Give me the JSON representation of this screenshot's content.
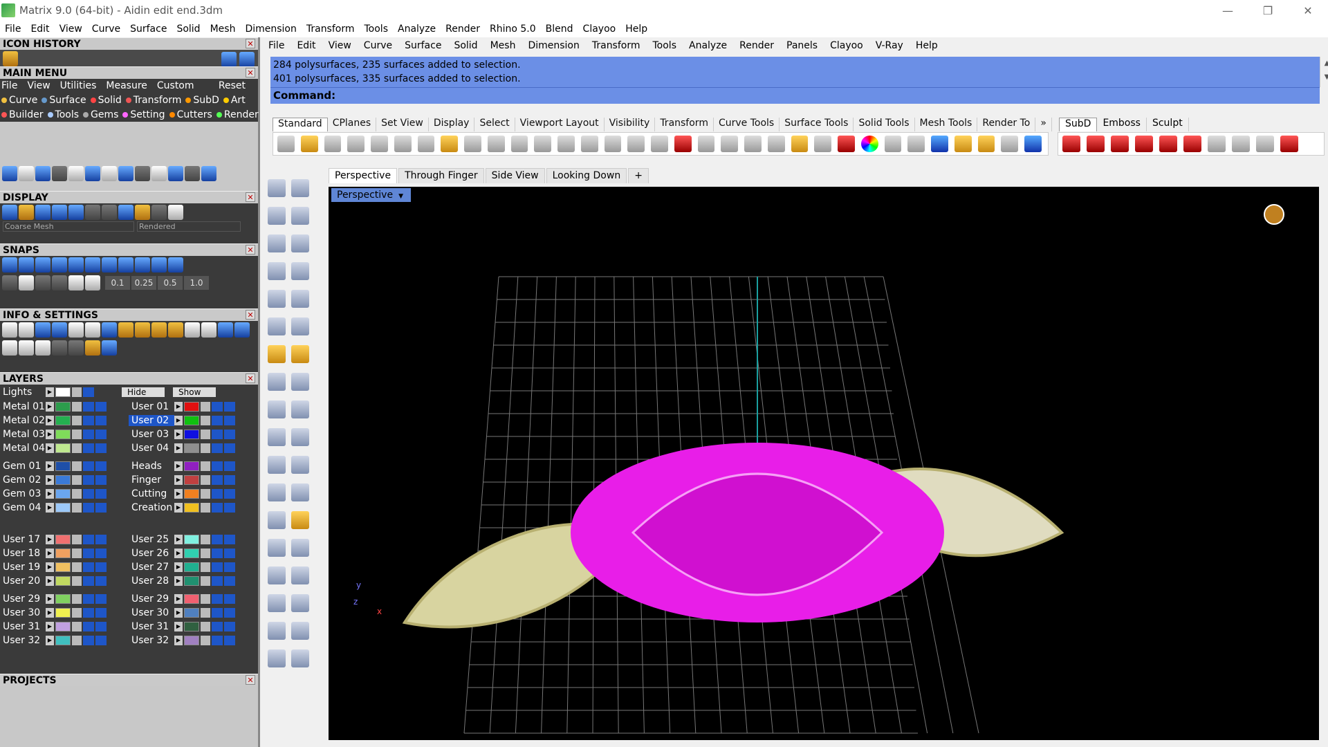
{
  "window": {
    "title": "Matrix 9.0 (64-bit) - Aidin edit end.3dm",
    "min": "—",
    "max": "❐",
    "close": "✕"
  },
  "menubar": [
    "File",
    "Edit",
    "View",
    "Curve",
    "Surface",
    "Solid",
    "Mesh",
    "Dimension",
    "Transform",
    "Tools",
    "Analyze",
    "Render",
    "Rhino 5.0",
    "Blend",
    "Clayoo",
    "Help"
  ],
  "left": {
    "icon_history": "ICON HISTORY",
    "main_menu": "MAIN MENU",
    "mm_tabs": [
      "File",
      "View",
      "Utilities",
      "Measure",
      "Custom",
      "Reset"
    ],
    "mm_row1": [
      {
        "t": "Curve",
        "c": "#f0c040"
      },
      {
        "t": "Surface",
        "c": "#69c"
      },
      {
        "t": "Solid",
        "c": "#f44"
      },
      {
        "t": "Transform",
        "c": "#e55"
      },
      {
        "t": "SubD",
        "c": "#f90"
      },
      {
        "t": "Art",
        "c": "#fc0"
      }
    ],
    "mm_row2": [
      {
        "t": "Builder",
        "c": "#f55"
      },
      {
        "t": "Tools",
        "c": "#acf"
      },
      {
        "t": "Gems",
        "c": "#aaa"
      },
      {
        "t": "Setting",
        "c": "#f6f"
      },
      {
        "t": "Cutters",
        "c": "#f80"
      },
      {
        "t": "Render",
        "c": "#5f5"
      }
    ],
    "display": "DISPLAY",
    "display_mesh": "Coarse Mesh",
    "display_mode": "Rendered",
    "snaps": "SNAPS",
    "snap_vals": [
      "0.1",
      "0.25",
      "0.5",
      "1.0"
    ],
    "info": "INFO & SETTINGS",
    "layers": "LAYERS",
    "lights": "Lights",
    "hide": "Hide",
    "show": "Show",
    "layers_left": [
      {
        "n": "Metal 01",
        "c": "#2c9c4c"
      },
      {
        "n": "Metal 02",
        "c": "#24b050"
      },
      {
        "n": "Metal 03",
        "c": "#7fdc5a"
      },
      {
        "n": "Metal 04",
        "c": "#bfe88f"
      },
      {
        "n": "Gem 01",
        "c": "#1e4fa8"
      },
      {
        "n": "Gem 02",
        "c": "#3a7ad8"
      },
      {
        "n": "Gem 03",
        "c": "#6aa6f0"
      },
      {
        "n": "Gem 04",
        "c": "#9cc8f8"
      },
      {
        "n": "User 17",
        "c": "#f07070"
      },
      {
        "n": "User 18",
        "c": "#f0a060"
      },
      {
        "n": "User 19",
        "c": "#f0c060"
      },
      {
        "n": "User 20",
        "c": "#c0d860"
      },
      {
        "n": "User 29",
        "c": "#80d060"
      },
      {
        "n": "User 30",
        "c": "#f0f050"
      },
      {
        "n": "User 31",
        "c": "#c0a0e0"
      },
      {
        "n": "User 32",
        "c": "#40c0c0"
      }
    ],
    "layers_right": [
      {
        "n": "User 01",
        "c": "#e01010"
      },
      {
        "n": "User 02",
        "c": "#10c010"
      },
      {
        "n": "User 03",
        "c": "#1010e0"
      },
      {
        "n": "User 04",
        "c": "#909090"
      },
      {
        "n": "Heads",
        "c": "#9020c0"
      },
      {
        "n": "Finger",
        "c": "#c04040"
      },
      {
        "n": "Cutting",
        "c": "#f08020"
      },
      {
        "n": "Creation",
        "c": "#f0c020"
      },
      {
        "n": "User 25",
        "c": "#80f0e0"
      },
      {
        "n": "User 26",
        "c": "#30d0b0"
      },
      {
        "n": "User 27",
        "c": "#20b090"
      },
      {
        "n": "User 28",
        "c": "#209070"
      },
      {
        "n": "User 29",
        "c": "#f06070"
      },
      {
        "n": "User 30",
        "c": "#5080c0"
      },
      {
        "n": "User 31",
        "c": "#306040"
      },
      {
        "n": "User 32",
        "c": "#a080c0"
      }
    ],
    "projects": "PROJECTS"
  },
  "rhino_menubar": [
    "File",
    "Edit",
    "View",
    "Curve",
    "Surface",
    "Solid",
    "Mesh",
    "Dimension",
    "Transform",
    "Tools",
    "Analyze",
    "Render",
    "Panels",
    "Clayoo",
    "V-Ray",
    "Help"
  ],
  "command_history": [
    "284 polysurfaces, 235 surfaces added to selection.",
    "401 polysurfaces, 335 surfaces added to selection."
  ],
  "command_prompt": "Command:",
  "toolbar_tabs": [
    "Standard",
    "CPlanes",
    "Set View",
    "Display",
    "Select",
    "Viewport Layout",
    "Visibility",
    "Transform",
    "Curve Tools",
    "Surface Tools",
    "Solid Tools",
    "Mesh Tools",
    "Render To",
    "»"
  ],
  "toolbar_tabs2": [
    "SubD",
    "Emboss",
    "Sculpt"
  ],
  "viewport_tabs": [
    "Perspective",
    "Through Finger",
    "Side View",
    "Looking Down",
    "+"
  ],
  "viewport_label": "Perspective",
  "axis": {
    "y": "y",
    "z": "z",
    "x": "x"
  }
}
